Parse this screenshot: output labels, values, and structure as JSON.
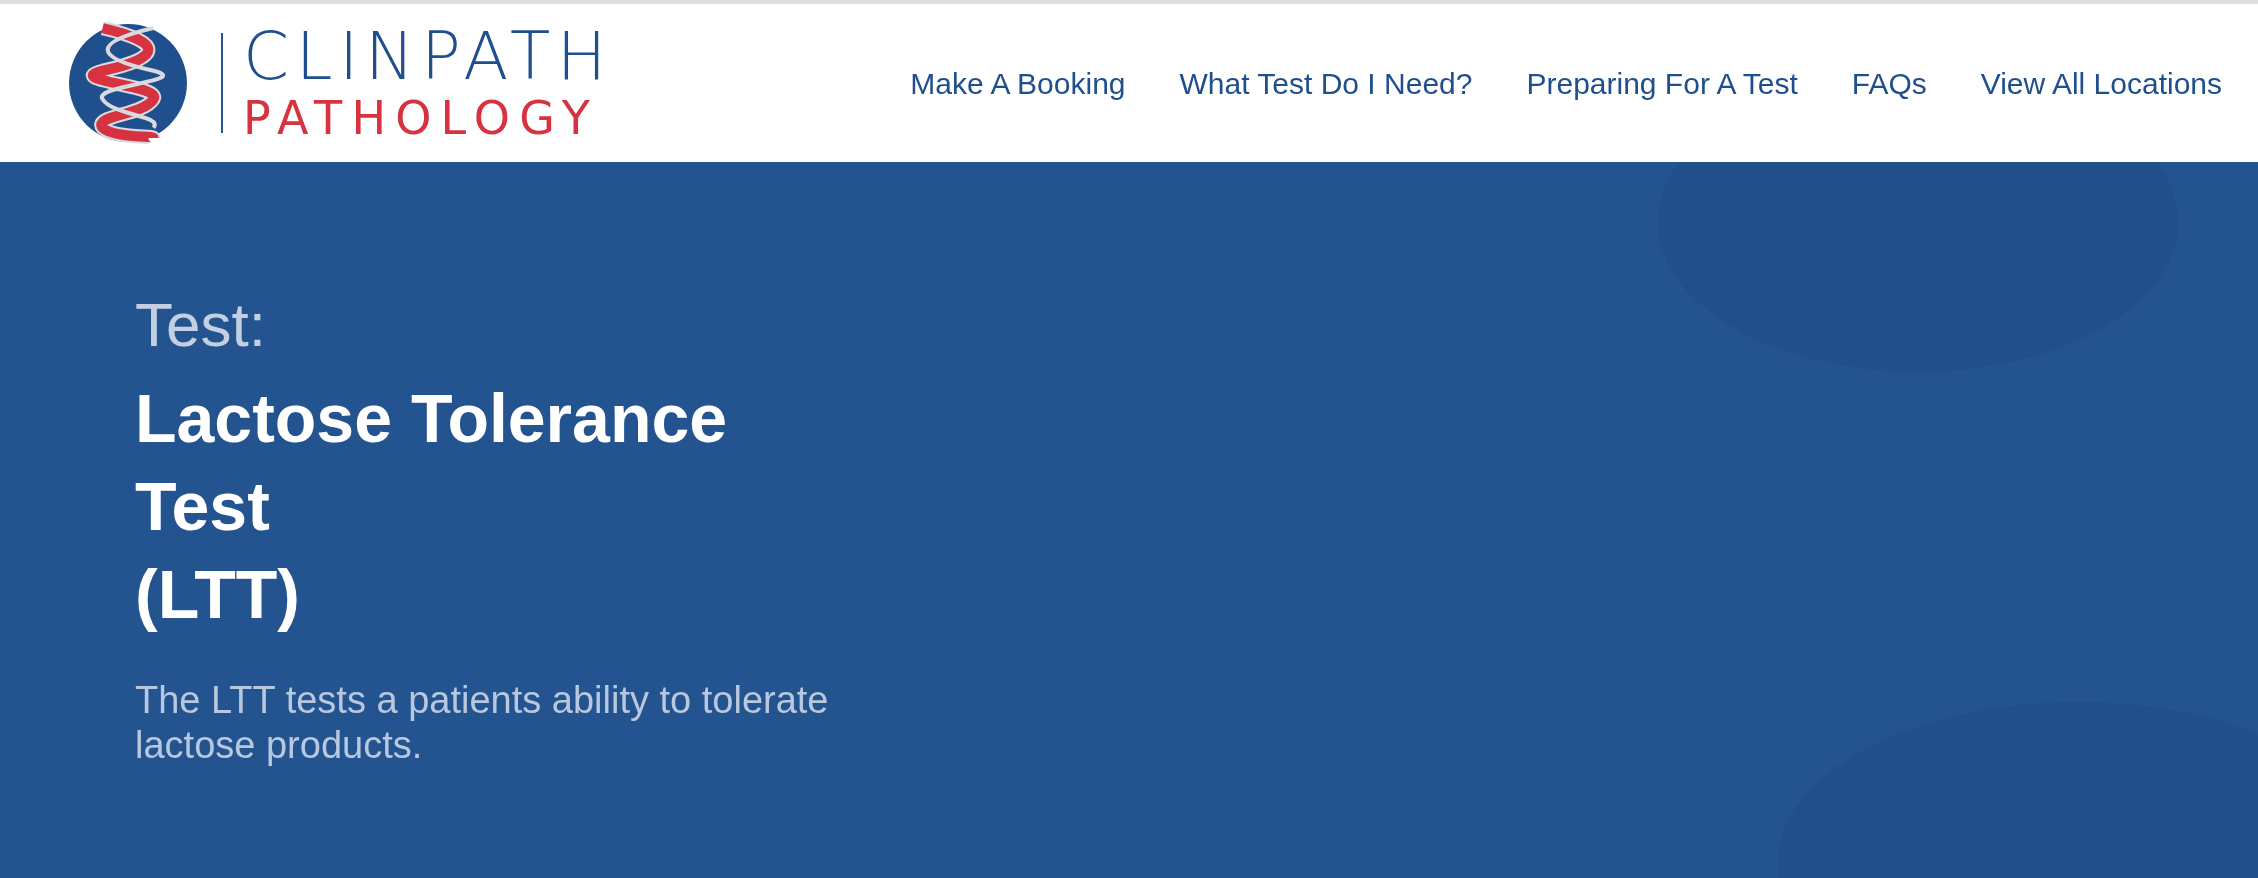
{
  "logo": {
    "name": "CLINPATH",
    "subtitle": "PATHOLOGY"
  },
  "nav": [
    {
      "label": "Make A Booking"
    },
    {
      "label": "What Test Do I Need?"
    },
    {
      "label": "Preparing For A Test"
    },
    {
      "label": "FAQs"
    },
    {
      "label": "View All Locations"
    }
  ],
  "hero": {
    "eyebrow": "Test:",
    "title_lines": [
      "Lactose Tolerance",
      "Test",
      "(LTT)"
    ],
    "description": "The LTT tests a patients ability to tolerate lactose products."
  }
}
